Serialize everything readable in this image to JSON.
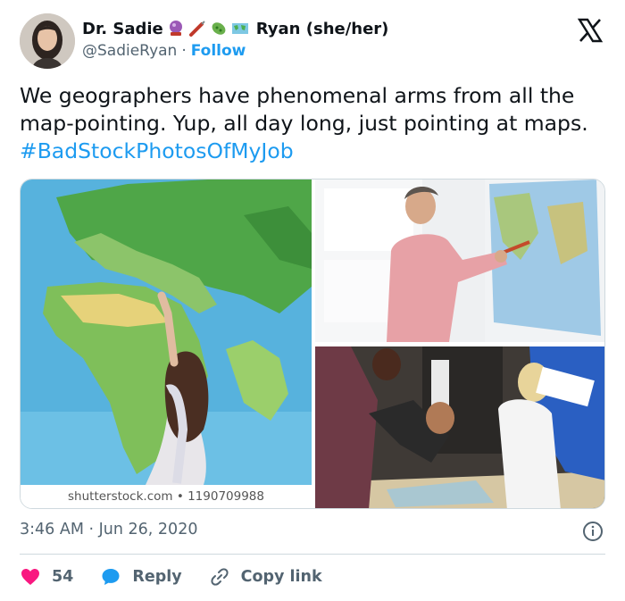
{
  "author": {
    "name_first": "Dr. Sadie",
    "name_last": "Ryan (she/her)",
    "handle": "@SadieRyan",
    "separator": "·",
    "follow_label": "Follow",
    "name_emojis": [
      "crystal-ball-icon",
      "syringe-icon",
      "microbe-icon",
      "world-map-icon"
    ]
  },
  "tweet": {
    "text": "We geographers have phenomenal arms from all the map-pointing. Yup, all day long, just pointing at maps. ",
    "hashtag": "#BadStockPhotosOfMyJob"
  },
  "media": {
    "watermark": "shutterstock.com • 1190709988"
  },
  "meta": {
    "timestamp": "3:46 AM · Jun 26, 2020"
  },
  "actions": {
    "likes_count": "54",
    "reply_label": "Reply",
    "copy_link_label": "Copy link"
  },
  "colors": {
    "accent": "#1d9bf0",
    "like": "#f91880",
    "text": "#0f1419",
    "muted": "#536471"
  }
}
